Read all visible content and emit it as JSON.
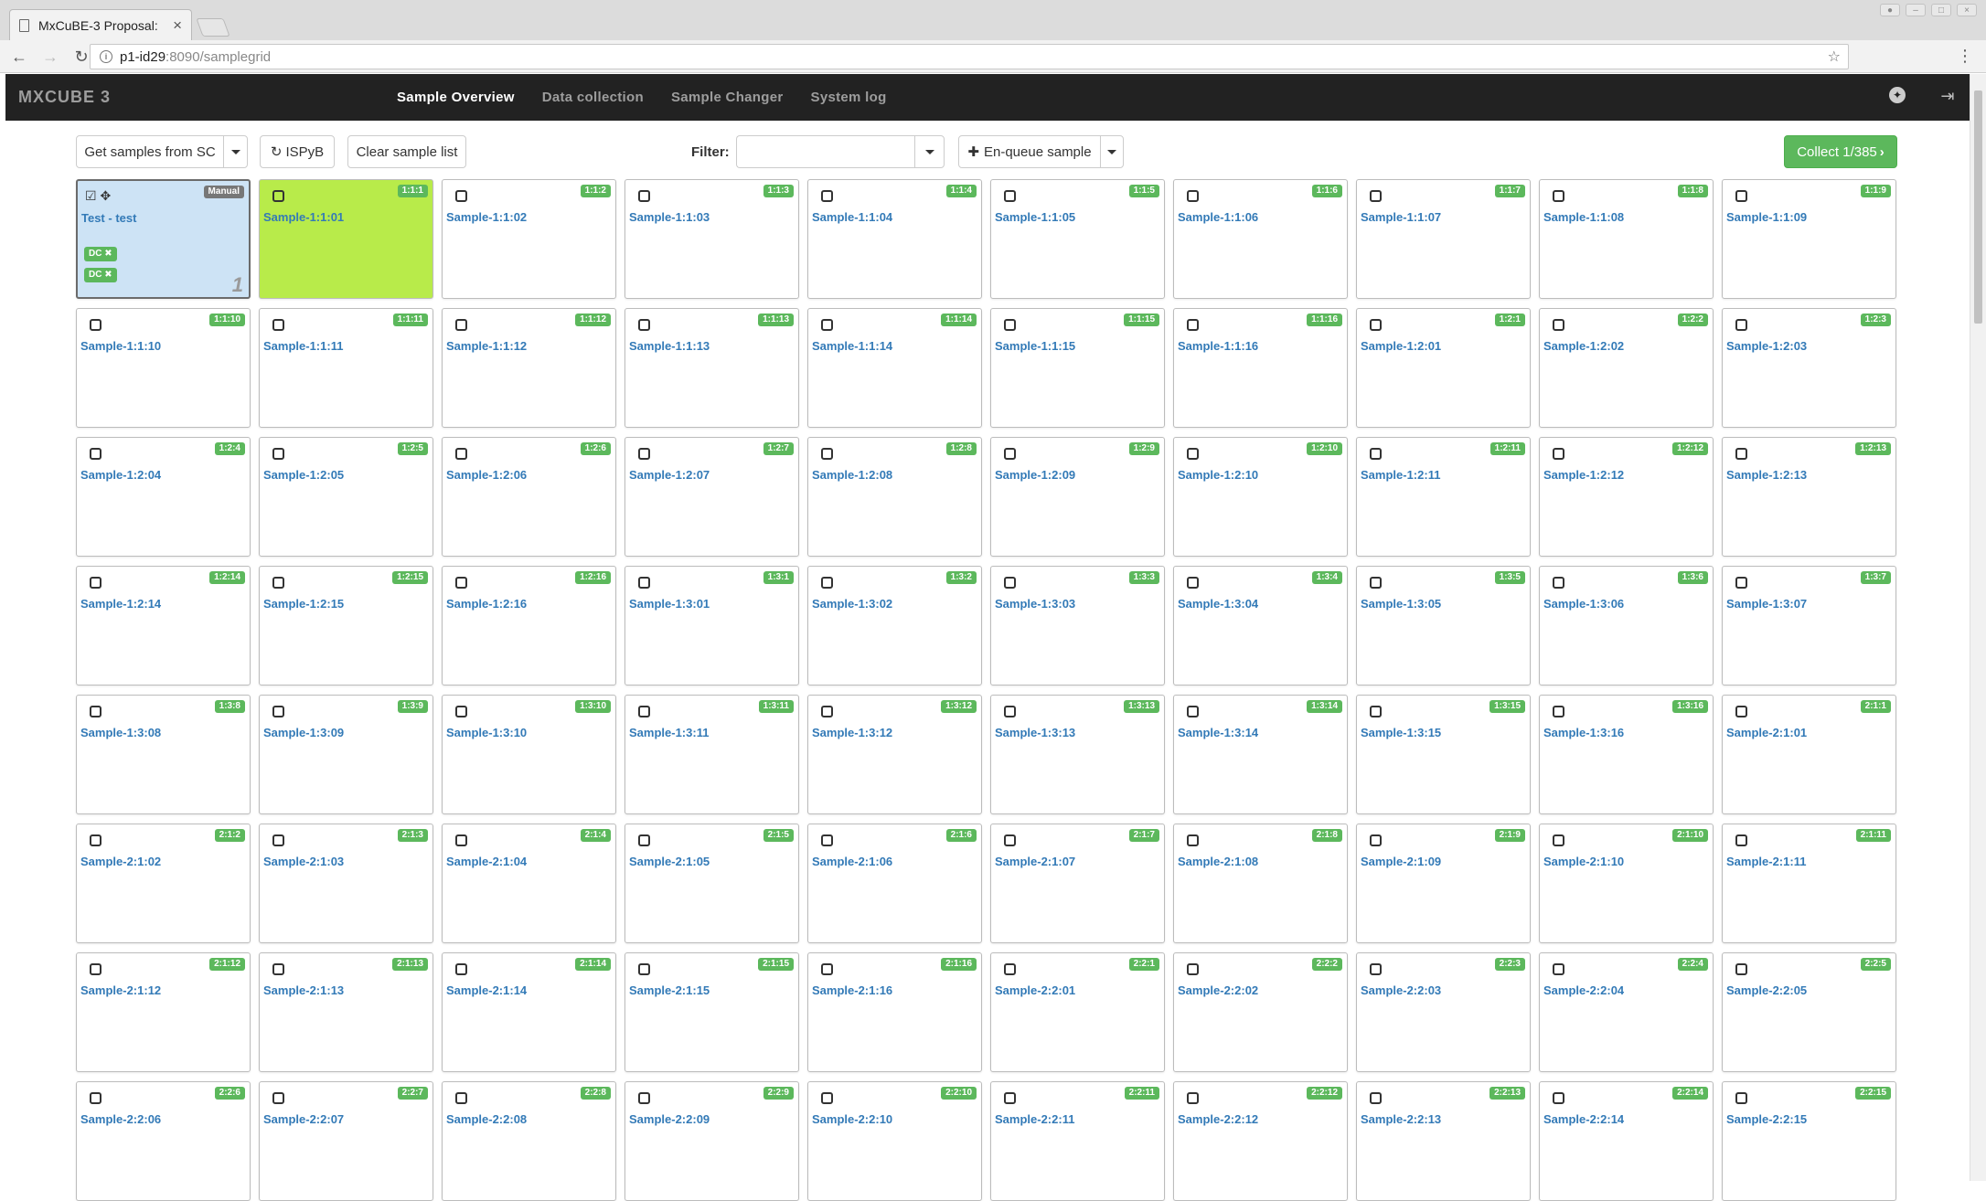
{
  "browser": {
    "tab_title": "MxCuBE-3 Proposal:",
    "url_host": "p1-id29",
    "url_path": ":8090/samplegrid"
  },
  "app": {
    "brand": "MXCUBE 3",
    "nav": [
      "Sample Overview",
      "Data collection",
      "Sample Changer",
      "System log"
    ],
    "active_nav": "Sample Overview"
  },
  "toolbar": {
    "get_samples": "Get samples from SC",
    "ispyb": "ISPyB",
    "clear": "Clear sample list",
    "filter_label": "Filter:",
    "enqueue": "En-queue sample",
    "collect": "Collect 1/385"
  },
  "colors": {
    "accent_green": "#5cb85c",
    "selected_sample": "#b8eb4a",
    "manual_sample": "#cde3f5",
    "link_blue": "#337ab7",
    "navbar": "#222222"
  },
  "samples": [
    {
      "name": "Test - test",
      "loc": "Manual",
      "manual": true,
      "dcs": [
        "DC",
        "DC"
      ],
      "queue": "1"
    },
    {
      "name": "Sample-1:1:01",
      "loc": "1:1:1",
      "selected": true
    },
    {
      "name": "Sample-1:1:02",
      "loc": "1:1:2"
    },
    {
      "name": "Sample-1:1:03",
      "loc": "1:1:3"
    },
    {
      "name": "Sample-1:1:04",
      "loc": "1:1:4"
    },
    {
      "name": "Sample-1:1:05",
      "loc": "1:1:5"
    },
    {
      "name": "Sample-1:1:06",
      "loc": "1:1:6"
    },
    {
      "name": "Sample-1:1:07",
      "loc": "1:1:7"
    },
    {
      "name": "Sample-1:1:08",
      "loc": "1:1:8"
    },
    {
      "name": "Sample-1:1:09",
      "loc": "1:1:9"
    },
    {
      "name": "Sample-1:1:10",
      "loc": "1:1:10"
    },
    {
      "name": "Sample-1:1:11",
      "loc": "1:1:11"
    },
    {
      "name": "Sample-1:1:12",
      "loc": "1:1:12"
    },
    {
      "name": "Sample-1:1:13",
      "loc": "1:1:13"
    },
    {
      "name": "Sample-1:1:14",
      "loc": "1:1:14"
    },
    {
      "name": "Sample-1:1:15",
      "loc": "1:1:15"
    },
    {
      "name": "Sample-1:1:16",
      "loc": "1:1:16"
    },
    {
      "name": "Sample-1:2:01",
      "loc": "1:2:1"
    },
    {
      "name": "Sample-1:2:02",
      "loc": "1:2:2"
    },
    {
      "name": "Sample-1:2:03",
      "loc": "1:2:3"
    },
    {
      "name": "Sample-1:2:04",
      "loc": "1:2:4"
    },
    {
      "name": "Sample-1:2:05",
      "loc": "1:2:5"
    },
    {
      "name": "Sample-1:2:06",
      "loc": "1:2:6"
    },
    {
      "name": "Sample-1:2:07",
      "loc": "1:2:7"
    },
    {
      "name": "Sample-1:2:08",
      "loc": "1:2:8"
    },
    {
      "name": "Sample-1:2:09",
      "loc": "1:2:9"
    },
    {
      "name": "Sample-1:2:10",
      "loc": "1:2:10"
    },
    {
      "name": "Sample-1:2:11",
      "loc": "1:2:11"
    },
    {
      "name": "Sample-1:2:12",
      "loc": "1:2:12"
    },
    {
      "name": "Sample-1:2:13",
      "loc": "1:2:13"
    },
    {
      "name": "Sample-1:2:14",
      "loc": "1:2:14"
    },
    {
      "name": "Sample-1:2:15",
      "loc": "1:2:15"
    },
    {
      "name": "Sample-1:2:16",
      "loc": "1:2:16"
    },
    {
      "name": "Sample-1:3:01",
      "loc": "1:3:1"
    },
    {
      "name": "Sample-1:3:02",
      "loc": "1:3:2"
    },
    {
      "name": "Sample-1:3:03",
      "loc": "1:3:3"
    },
    {
      "name": "Sample-1:3:04",
      "loc": "1:3:4"
    },
    {
      "name": "Sample-1:3:05",
      "loc": "1:3:5"
    },
    {
      "name": "Sample-1:3:06",
      "loc": "1:3:6"
    },
    {
      "name": "Sample-1:3:07",
      "loc": "1:3:7"
    },
    {
      "name": "Sample-1:3:08",
      "loc": "1:3:8"
    },
    {
      "name": "Sample-1:3:09",
      "loc": "1:3:9"
    },
    {
      "name": "Sample-1:3:10",
      "loc": "1:3:10"
    },
    {
      "name": "Sample-1:3:11",
      "loc": "1:3:11"
    },
    {
      "name": "Sample-1:3:12",
      "loc": "1:3:12"
    },
    {
      "name": "Sample-1:3:13",
      "loc": "1:3:13"
    },
    {
      "name": "Sample-1:3:14",
      "loc": "1:3:14"
    },
    {
      "name": "Sample-1:3:15",
      "loc": "1:3:15"
    },
    {
      "name": "Sample-1:3:16",
      "loc": "1:3:16"
    },
    {
      "name": "Sample-2:1:01",
      "loc": "2:1:1"
    },
    {
      "name": "Sample-2:1:02",
      "loc": "2:1:2"
    },
    {
      "name": "Sample-2:1:03",
      "loc": "2:1:3"
    },
    {
      "name": "Sample-2:1:04",
      "loc": "2:1:4"
    },
    {
      "name": "Sample-2:1:05",
      "loc": "2:1:5"
    },
    {
      "name": "Sample-2:1:06",
      "loc": "2:1:6"
    },
    {
      "name": "Sample-2:1:07",
      "loc": "2:1:7"
    },
    {
      "name": "Sample-2:1:08",
      "loc": "2:1:8"
    },
    {
      "name": "Sample-2:1:09",
      "loc": "2:1:9"
    },
    {
      "name": "Sample-2:1:10",
      "loc": "2:1:10"
    },
    {
      "name": "Sample-2:1:11",
      "loc": "2:1:11"
    },
    {
      "name": "Sample-2:1:12",
      "loc": "2:1:12"
    },
    {
      "name": "Sample-2:1:13",
      "loc": "2:1:13"
    },
    {
      "name": "Sample-2:1:14",
      "loc": "2:1:14"
    },
    {
      "name": "Sample-2:1:15",
      "loc": "2:1:15"
    },
    {
      "name": "Sample-2:1:16",
      "loc": "2:1:16"
    },
    {
      "name": "Sample-2:2:01",
      "loc": "2:2:1"
    },
    {
      "name": "Sample-2:2:02",
      "loc": "2:2:2"
    },
    {
      "name": "Sample-2:2:03",
      "loc": "2:2:3"
    },
    {
      "name": "Sample-2:2:04",
      "loc": "2:2:4"
    },
    {
      "name": "Sample-2:2:05",
      "loc": "2:2:5"
    },
    {
      "name": "Sample-2:2:06",
      "loc": "2:2:6"
    },
    {
      "name": "Sample-2:2:07",
      "loc": "2:2:7"
    },
    {
      "name": "Sample-2:2:08",
      "loc": "2:2:8"
    },
    {
      "name": "Sample-2:2:09",
      "loc": "2:2:9"
    },
    {
      "name": "Sample-2:2:10",
      "loc": "2:2:10"
    },
    {
      "name": "Sample-2:2:11",
      "loc": "2:2:11"
    },
    {
      "name": "Sample-2:2:12",
      "loc": "2:2:12"
    },
    {
      "name": "Sample-2:2:13",
      "loc": "2:2:13"
    },
    {
      "name": "Sample-2:2:14",
      "loc": "2:2:14"
    },
    {
      "name": "Sample-2:2:15",
      "loc": "2:2:15"
    }
  ]
}
